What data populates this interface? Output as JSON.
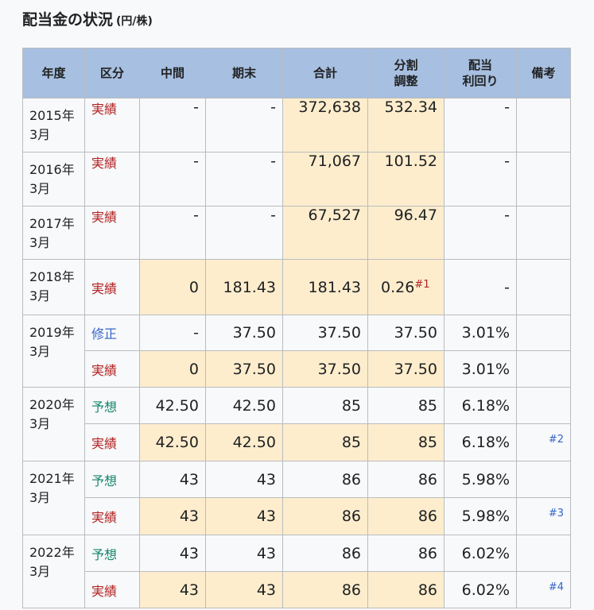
{
  "title": "配当金の状況",
  "title_unit": "(円/株)",
  "headers": {
    "year": "年度",
    "kind": "区分",
    "interim": "中間",
    "final": "期末",
    "total": "合計",
    "adj_1": "分割",
    "adj_2": "調整",
    "yield_1": "配当",
    "yield_2": "利回り",
    "note": "備考"
  },
  "rows": [
    {
      "year_1": "2015年",
      "year_2": "3月",
      "kind": "実績",
      "interim": "-",
      "final": "-",
      "total": "372,638",
      "adjusted": "532.34",
      "yield": "-",
      "note": ""
    },
    {
      "year_1": "2016年",
      "year_2": "3月",
      "kind": "実績",
      "interim": "-",
      "final": "-",
      "total": "71,067",
      "adjusted": "101.52",
      "yield": "-",
      "note": ""
    },
    {
      "year_1": "2017年",
      "year_2": "3月",
      "kind": "実績",
      "interim": "-",
      "final": "-",
      "total": "67,527",
      "adjusted": "96.47",
      "yield": "-",
      "note": ""
    },
    {
      "year_1": "2018年",
      "year_2": "3月",
      "kind": "実績",
      "interim": "0",
      "final": "181.43",
      "total": "181.43",
      "adjusted": "0.26",
      "adjusted_ref": "#1",
      "yield": "-",
      "note": ""
    },
    {
      "year_1": "2019年",
      "year_2": "3月",
      "kind": "修正",
      "interim": "-",
      "final": "37.50",
      "total": "37.50",
      "adjusted": "37.50",
      "yield": "3.01%",
      "note": ""
    },
    {
      "kind": "実績",
      "interim": "0",
      "final": "37.50",
      "total": "37.50",
      "adjusted": "37.50",
      "yield": "3.01%",
      "note": ""
    },
    {
      "year_1": "2020年",
      "year_2": "3月",
      "kind": "予想",
      "interim": "42.50",
      "final": "42.50",
      "total": "85",
      "adjusted": "85",
      "yield": "6.18%",
      "note": ""
    },
    {
      "kind": "実績",
      "interim": "42.50",
      "final": "42.50",
      "total": "85",
      "adjusted": "85",
      "yield": "6.18%",
      "note": "#2"
    },
    {
      "year_1": "2021年",
      "year_2": "3月",
      "kind": "予想",
      "interim": "43",
      "final": "43",
      "total": "86",
      "adjusted": "86",
      "yield": "5.98%",
      "note": ""
    },
    {
      "kind": "実績",
      "interim": "43",
      "final": "43",
      "total": "86",
      "adjusted": "86",
      "yield": "5.98%",
      "note": "#3"
    },
    {
      "year_1": "2022年",
      "year_2": "3月",
      "kind": "予想",
      "interim": "43",
      "final": "43",
      "total": "86",
      "adjusted": "86",
      "yield": "6.02%",
      "note": ""
    },
    {
      "kind": "実績",
      "interim": "43",
      "final": "43",
      "total": "86",
      "adjusted": "86",
      "yield": "6.02%",
      "note": "#4"
    }
  ],
  "colors": {
    "header_bg": "#a7bfe0",
    "highlight_bg": "#fdedcd",
    "actual_red": "#b32424",
    "revised_blue": "#3366cc",
    "forecast_green": "#14866d"
  }
}
